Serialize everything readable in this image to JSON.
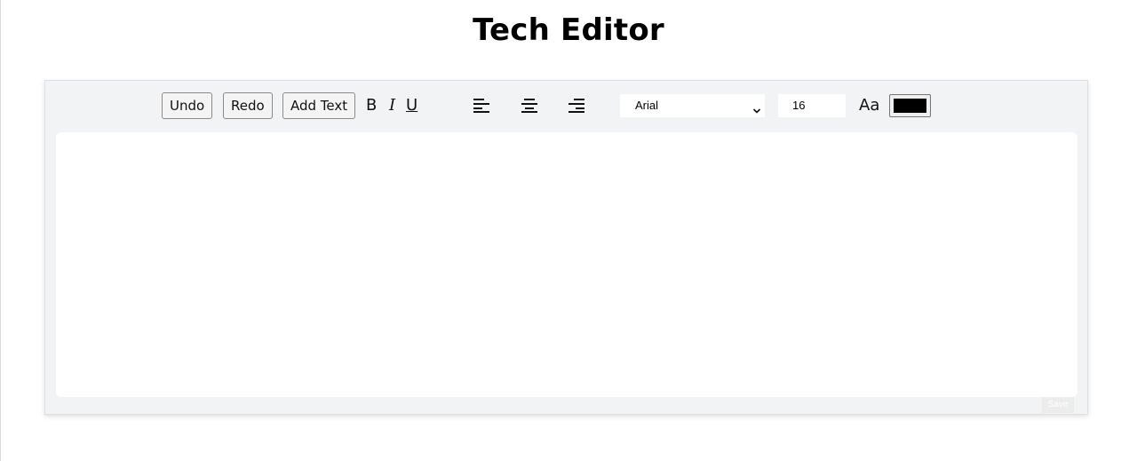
{
  "page": {
    "title": "Tech Editor"
  },
  "toolbar": {
    "undo_label": "Undo",
    "redo_label": "Redo",
    "add_text_label": "Add Text",
    "bold_label": "B",
    "italic_label": "I",
    "underline_label": "U",
    "align_icons": [
      "align-left-icon",
      "align-center-icon",
      "align-right-icon"
    ],
    "font_family": {
      "selected": "Arial"
    },
    "font_size": {
      "value": "16"
    },
    "case_toggle_label": "Aa",
    "text_color": "#000000"
  },
  "editor": {
    "content": ""
  },
  "footer": {
    "save_label": "Save"
  },
  "colors": {
    "container_background": "#f2f3f5",
    "editor_background": "#ffffff",
    "save_button_background": "#ececec"
  }
}
